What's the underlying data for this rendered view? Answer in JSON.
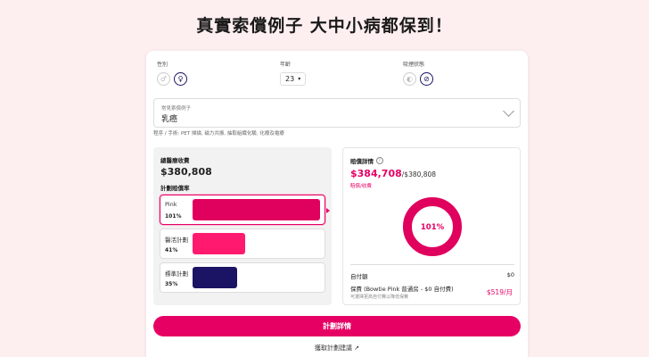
{
  "headline": "真實索償例子 大中小病都保到！",
  "filters": {
    "gender_label": "性別",
    "age_label": "年齡",
    "age_value": "23",
    "smoking_label": "吸煙狀態"
  },
  "claim_example": {
    "label": "常見索償例子",
    "value": "乳癌"
  },
  "procedures": "程序 / 手術: PET 掃描, 磁力共振, 抽取組織化驗, 化療及電療",
  "left_panel": {
    "total_label": "總醫療收費",
    "total_amount": "$380,808",
    "rate_label": "計劃賠償率",
    "plans": [
      {
        "name": "Pink",
        "pct": "101%",
        "fill": 1.0,
        "color": "#e0005e"
      },
      {
        "name": "醫活計劃",
        "pct": "41%",
        "fill": 0.41,
        "color": "#ff1a70"
      },
      {
        "name": "標準計劃",
        "pct": "35%",
        "fill": 0.35,
        "color": "#1b1464"
      }
    ]
  },
  "right_panel": {
    "title": "賠償詳情",
    "info_icon": "i",
    "amount": "$384,708",
    "total": "/$380,808",
    "sub": "賠償/收費",
    "donut_pct": "101%",
    "donut_fill": 1.0,
    "deductible_label": "自付額",
    "deductible_value": "$0",
    "premium_label": "保費 (Bowtie Pink 普通房 - $0 自付費)",
    "premium_note": "可選擇更高自付費以降低保費",
    "premium_value": "$519/月"
  },
  "cta_label": "計劃詳情",
  "link_label": "獲取計劃建議 ↗",
  "colors": {
    "accent": "#e60064",
    "navy": "#1b1464",
    "background": "#fdeef0"
  }
}
